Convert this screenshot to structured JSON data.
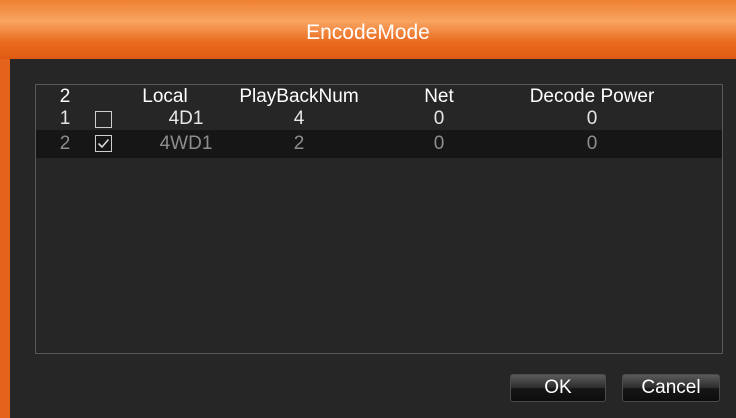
{
  "dialog": {
    "title": "EncodeMode"
  },
  "table": {
    "headers": {
      "index": "2",
      "local": "Local",
      "playback": "PlayBackNum",
      "net": "Net",
      "decode_power": "Decode Power"
    },
    "rows": [
      {
        "index": "1",
        "checked": false,
        "local": "4D1",
        "playback": "4",
        "net": "0",
        "decode_power": "0"
      },
      {
        "index": "2",
        "checked": true,
        "local": "4WD1",
        "playback": "2",
        "net": "0",
        "decode_power": "0"
      }
    ]
  },
  "buttons": {
    "ok": "OK",
    "cancel": "Cancel"
  },
  "colors": {
    "title_bar": "#f08a3e",
    "accent_border": "#e5621b",
    "background": "#262626",
    "selected_row": "#161616"
  }
}
